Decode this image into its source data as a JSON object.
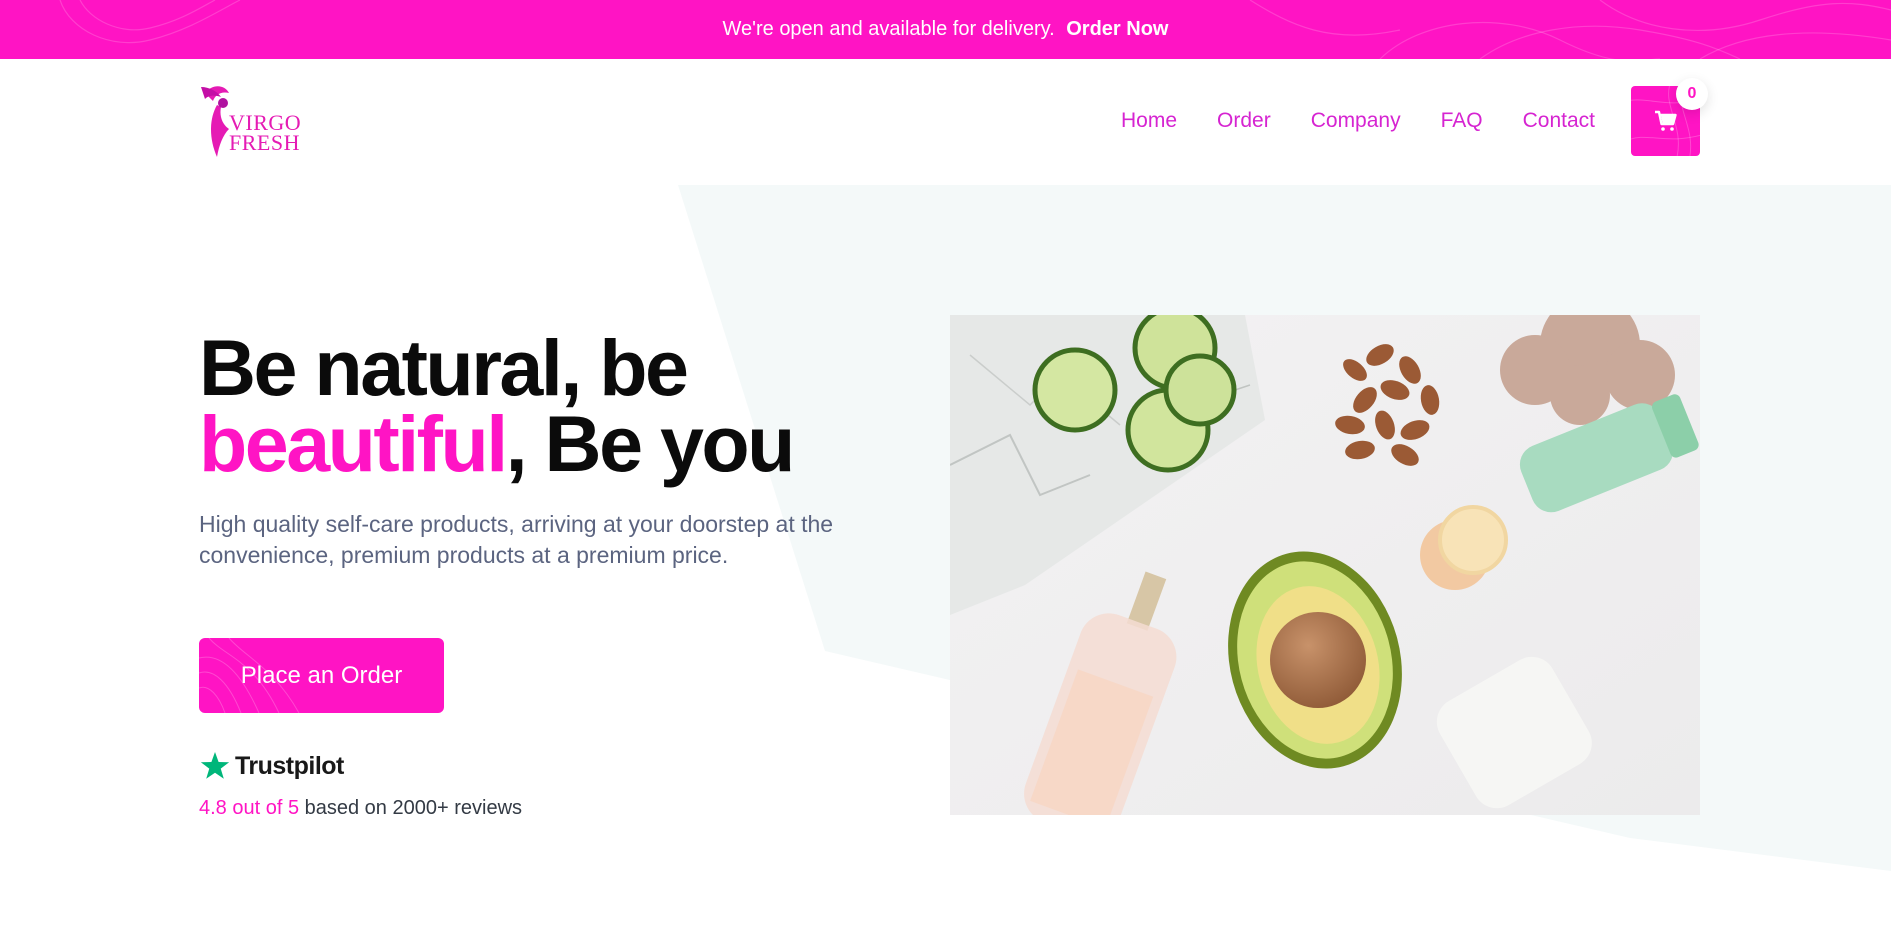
{
  "announcement": {
    "message": "We're open and available for delivery.",
    "link_label": "Order Now"
  },
  "brand": {
    "logo_line1": "VIRGO",
    "logo_line2": "FRESH"
  },
  "nav": {
    "items": [
      {
        "label": "Home"
      },
      {
        "label": "Order"
      },
      {
        "label": "Company"
      },
      {
        "label": "FAQ"
      },
      {
        "label": "Contact"
      }
    ]
  },
  "cart": {
    "count": "0",
    "icon": "cart-icon"
  },
  "hero": {
    "title_part1": "Be natural, be",
    "title_highlight": "beautiful",
    "title_part2": ", Be you",
    "subtitle": "High quality self-care products, arriving at your doorstep at the convenience, premium products at a premium price.",
    "cta_label": "Place an Order"
  },
  "trustpilot": {
    "name": "Trustpilot",
    "icon": "star-icon",
    "score_text": "4.8 out of 5",
    "reviews_text": " based on 2000+ reviews"
  },
  "colors": {
    "accent": "#ff14c4",
    "nav_link": "#d624d1",
    "trust_green": "#00b67a",
    "subtitle": "#5b6480"
  }
}
